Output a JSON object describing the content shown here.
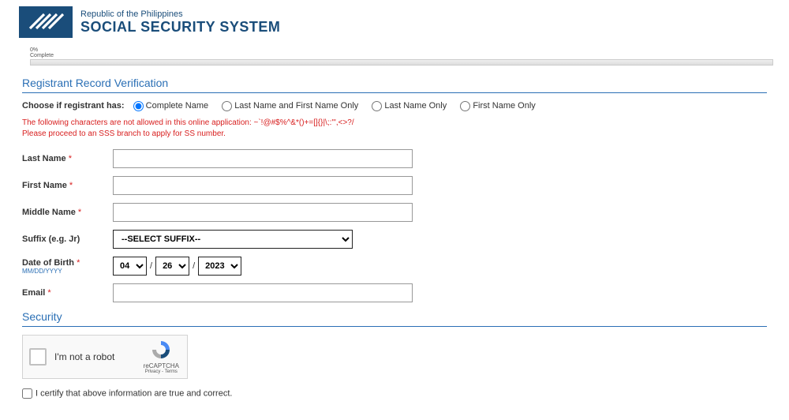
{
  "header": {
    "subtitle": "Republic of the Philippines",
    "title": "SOCIAL SECURITY SYSTEM"
  },
  "progress": {
    "percent": "0%",
    "label": "Complete"
  },
  "section1": {
    "title": "Registrant Record Verification",
    "prompt": "Choose if registrant has:",
    "options": {
      "complete": "Complete Name",
      "lastfirst": "Last Name and First Name Only",
      "last": "Last Name Only",
      "first": "First Name Only"
    },
    "warning_line1": "The following characters are not allowed in this online application: ~`!@#$%^&*()+=[]{}|\\;:'\",<>?/",
    "warning_line2": "Please proceed to an SSS branch to apply for SS number."
  },
  "fields": {
    "lastname": {
      "label": "Last Name",
      "value": ""
    },
    "firstname": {
      "label": "First Name",
      "value": ""
    },
    "middlename": {
      "label": "Middle Name",
      "value": ""
    },
    "suffix": {
      "label": "Suffix (e.g. Jr)",
      "selected": "--SELECT SUFFIX--"
    },
    "dob": {
      "label": "Date of Birth",
      "format": "MM/DD/YYYY",
      "month": "04",
      "day": "26",
      "year": "2023"
    },
    "email": {
      "label": "Email",
      "value": ""
    }
  },
  "section2": {
    "title": "Security",
    "recaptcha_text": "I'm not a robot",
    "recaptcha_brand": "reCAPTCHA",
    "recaptcha_links": "Privacy - Terms",
    "certify": "I certify that above information are true and correct."
  }
}
